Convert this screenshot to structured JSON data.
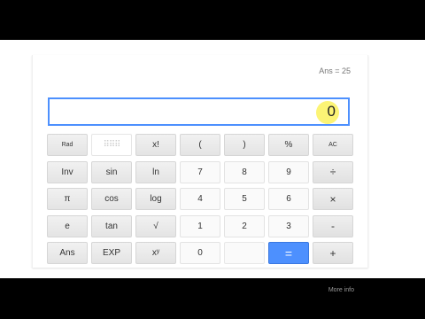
{
  "calculator": {
    "ans_label": "Ans = 25",
    "display_value": "0",
    "more_info": "More info",
    "keys": [
      {
        "label": "Rad",
        "kind": "fn small",
        "name": "rad-button"
      },
      {
        "label": "⠿⠿⠿",
        "kind": "dots",
        "name": "deg-button"
      },
      {
        "label": "x!",
        "kind": "fn",
        "name": "factorial-button"
      },
      {
        "label": "(",
        "kind": "fn",
        "name": "open-paren-button"
      },
      {
        "label": ")",
        "kind": "fn",
        "name": "close-paren-button"
      },
      {
        "label": "%",
        "kind": "fn",
        "name": "percent-button"
      },
      {
        "label": "AC",
        "kind": "fn small",
        "name": "all-clear-button"
      },
      {
        "label": "Inv",
        "kind": "fn",
        "name": "inverse-button"
      },
      {
        "label": "sin",
        "kind": "fn",
        "name": "sin-button"
      },
      {
        "label": "ln",
        "kind": "fn",
        "name": "ln-button"
      },
      {
        "label": "7",
        "kind": "num",
        "name": "digit-7-button"
      },
      {
        "label": "8",
        "kind": "num",
        "name": "digit-8-button"
      },
      {
        "label": "9",
        "kind": "num",
        "name": "digit-9-button"
      },
      {
        "label": "÷",
        "kind": "op",
        "name": "divide-button"
      },
      {
        "label": "π",
        "kind": "fn",
        "name": "pi-button"
      },
      {
        "label": "cos",
        "kind": "fn",
        "name": "cos-button"
      },
      {
        "label": "log",
        "kind": "fn",
        "name": "log-button"
      },
      {
        "label": "4",
        "kind": "num",
        "name": "digit-4-button"
      },
      {
        "label": "5",
        "kind": "num",
        "name": "digit-5-button"
      },
      {
        "label": "6",
        "kind": "num",
        "name": "digit-6-button"
      },
      {
        "label": "×",
        "kind": "op",
        "name": "multiply-button"
      },
      {
        "label": "e",
        "kind": "fn",
        "name": "e-button"
      },
      {
        "label": "tan",
        "kind": "fn",
        "name": "tan-button"
      },
      {
        "label": "√",
        "kind": "fn",
        "name": "sqrt-button"
      },
      {
        "label": "1",
        "kind": "num",
        "name": "digit-1-button"
      },
      {
        "label": "2",
        "kind": "num",
        "name": "digit-2-button"
      },
      {
        "label": "3",
        "kind": "num",
        "name": "digit-3-button"
      },
      {
        "label": "-",
        "kind": "op",
        "name": "subtract-button"
      },
      {
        "label": "Ans",
        "kind": "fn",
        "name": "ans-button"
      },
      {
        "label": "EXP",
        "kind": "fn",
        "name": "exp-button"
      },
      {
        "label": "xʸ",
        "kind": "fn",
        "name": "power-button"
      },
      {
        "label": "0",
        "kind": "num",
        "name": "digit-0-button"
      },
      {
        "label": "",
        "kind": "blank",
        "name": "decimal-button"
      },
      {
        "label": "=",
        "kind": "eq",
        "name": "equals-button"
      },
      {
        "label": "+",
        "kind": "op",
        "name": "add-button"
      }
    ]
  }
}
